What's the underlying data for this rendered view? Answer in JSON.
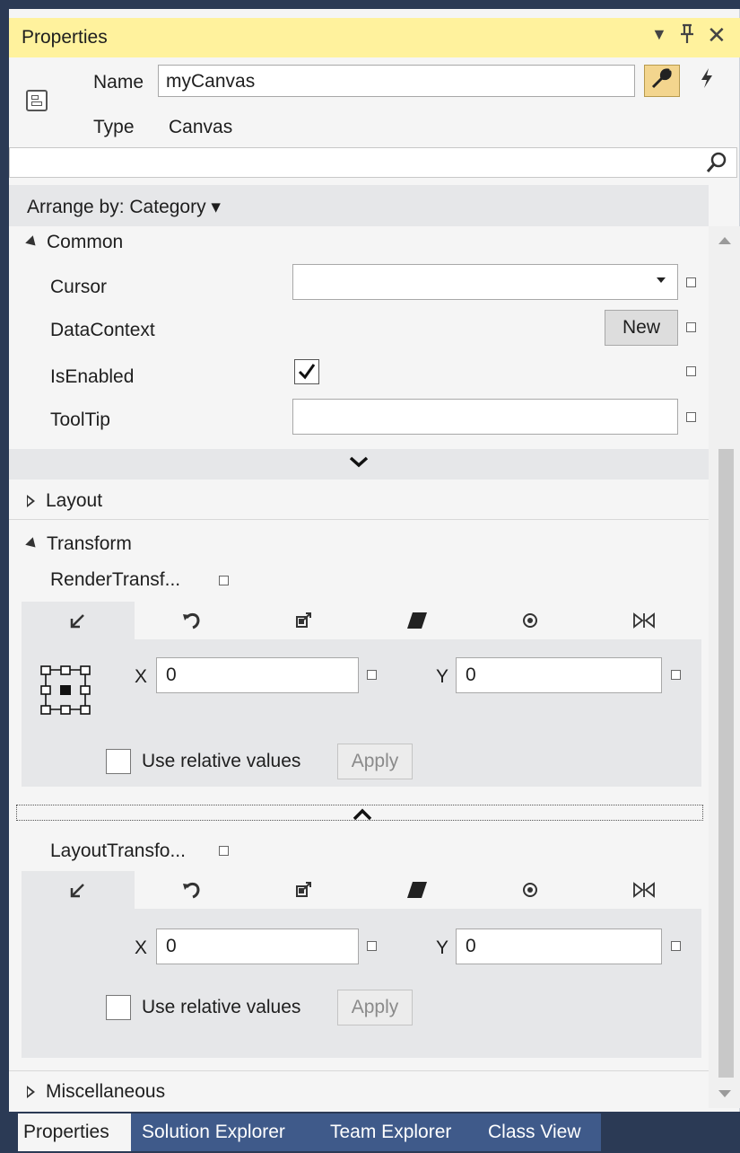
{
  "panel": {
    "title": "Properties",
    "dropdown_glyph": "▼",
    "pin_glyph": "ᵻ",
    "close_glyph": "✕"
  },
  "header": {
    "name_label": "Name",
    "name_value": "myCanvas",
    "type_label": "Type",
    "type_value": "Canvas",
    "object_icon": "canvas-icon",
    "properties_icon": "wrench-icon",
    "events_icon": "lightning-icon"
  },
  "search": {
    "placeholder": "",
    "icon": "search-icon"
  },
  "arrange": {
    "label": "Arrange by: Category ▾"
  },
  "categories": {
    "common": {
      "title": "Common",
      "cursor_label": "Cursor",
      "datacontext_label": "DataContext",
      "new_button": "New",
      "isenabled_label": "IsEnabled",
      "isenabled_checked": true,
      "tooltip_label": "ToolTip",
      "expand_glyph": "⌄"
    },
    "layout": {
      "title": "Layout"
    },
    "transform": {
      "title": "Transform",
      "render_label": "RenderTransf...",
      "layout_label": "LayoutTransfo...",
      "collapse_glyph": "⌃",
      "tab_icons": [
        "translate-icon",
        "rotate-icon",
        "scale-icon",
        "skew-icon",
        "center-point-icon",
        "flip-icon"
      ],
      "render": {
        "x_label": "X",
        "x_value": "0",
        "y_label": "Y",
        "y_value": "0",
        "relative_label": "Use relative values",
        "apply_label": "Apply"
      },
      "layout_transform": {
        "x_label": "X",
        "x_value": "0",
        "y_label": "Y",
        "y_value": "0",
        "relative_label": "Use relative values",
        "apply_label": "Apply"
      }
    },
    "misc": {
      "title": "Miscellaneous"
    }
  },
  "bottom_tabs": [
    "Properties",
    "Solution Explorer",
    "Team Explorer",
    "Class View"
  ],
  "colors": {
    "title_bg": "#fff29d",
    "frame": "#2b3a55",
    "tab_strip": "#3f5a8a",
    "panel_bg": "#f5f5f5",
    "active_button": "#f3d58e"
  }
}
